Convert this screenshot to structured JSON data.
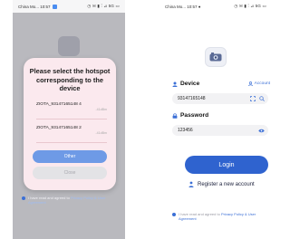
{
  "colors": {
    "accent": "#2f63cf",
    "dialog_bg": "#fbe9ee",
    "other_button": "#6e9ae6",
    "close_button": "#e3e3e6"
  },
  "left_screen": {
    "status": {
      "left": "China Mo... 10:57",
      "right": "◷ ✉ ▮ ⫶ ⊿ 5G ▭"
    },
    "dialog": {
      "title": "Please select the hotspot corresponding to the device",
      "items": [
        {
          "ssid": "ZIOTA_93147165148 4",
          "signal": "-41dBm"
        },
        {
          "ssid": "ZIOTA_93147165148 2",
          "signal": "-41dBm"
        }
      ],
      "other_label": "Other",
      "close_label": "Close"
    },
    "agreement": {
      "prefix": "I have read and agreed to ",
      "link": "Privacy Policy & User Agreement"
    }
  },
  "right_screen": {
    "status": {
      "left": "China Mo... 10:57 ●",
      "right": "◷ ✉ ▮ ⫶ ⊿ 5G ▭"
    },
    "device_label": "Device",
    "account_link": "Account",
    "device_value": "93147165148",
    "password_label": "Password",
    "password_value": "123456",
    "login_label": "Login",
    "register_label": "Register a new account",
    "agreement": {
      "prefix": "I have read and agreed to ",
      "link": "Privacy Policy & User Agreement"
    }
  }
}
